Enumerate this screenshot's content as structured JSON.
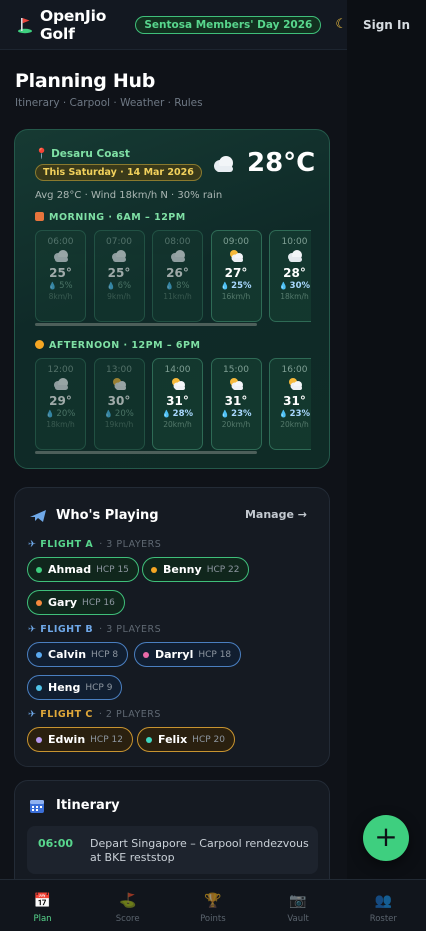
{
  "header": {
    "app_name": "OpenJio Golf",
    "event_pill": "Sentosa Members' Day 2026",
    "theme_icon": "moon-icon",
    "sign_in": "Sign In"
  },
  "hub": {
    "title": "Planning Hub",
    "subtitle": "Itinerary · Carpool · Weather · Rules"
  },
  "weather": {
    "location": "Desaru Coast",
    "date_pill": "This Saturday · 14 Mar 2026",
    "temperature": "28°C",
    "summary": "Avg 28°C · Wind 18km/h N · 30% rain",
    "morning": {
      "label": "MORNING · 6AM – 12PM",
      "hours": [
        {
          "time": "06:00",
          "icon": "cloud-icon",
          "temp": "25°",
          "rain": "5%",
          "wind": "8km/h",
          "highlight": false
        },
        {
          "time": "07:00",
          "icon": "cloud-icon",
          "temp": "25°",
          "rain": "6%",
          "wind": "9km/h",
          "highlight": false
        },
        {
          "time": "08:00",
          "icon": "cloud-icon",
          "temp": "26°",
          "rain": "8%",
          "wind": "11km/h",
          "highlight": false
        },
        {
          "time": "09:00",
          "icon": "partly-sunny-icon",
          "temp": "27°",
          "rain": "25%",
          "wind": "16km/h",
          "highlight": true
        },
        {
          "time": "10:00",
          "icon": "cloud-icon",
          "temp": "28°",
          "rain": "30%",
          "wind": "18km/h",
          "highlight": true
        }
      ]
    },
    "afternoon": {
      "label": "AFTERNOON · 12PM – 6PM",
      "hours": [
        {
          "time": "12:00",
          "icon": "cloud-icon",
          "temp": "29°",
          "rain": "20%",
          "wind": "18km/h",
          "highlight": false
        },
        {
          "time": "13:00",
          "icon": "partly-sunny-icon",
          "temp": "30°",
          "rain": "20%",
          "wind": "19km/h",
          "highlight": false
        },
        {
          "time": "14:00",
          "icon": "partly-sunny-icon",
          "temp": "31°",
          "rain": "28%",
          "wind": "20km/h",
          "highlight": true
        },
        {
          "time": "15:00",
          "icon": "partly-sunny-icon",
          "temp": "31°",
          "rain": "23%",
          "wind": "20km/h",
          "highlight": true
        },
        {
          "time": "16:00",
          "icon": "partly-sunny-icon",
          "temp": "31°",
          "rain": "23%",
          "wind": "20km/h",
          "highlight": true
        }
      ]
    }
  },
  "players": {
    "title": "Who's Playing",
    "manage": "Manage →",
    "flights": [
      {
        "name": "FLIGHT A",
        "count": "3 PLAYERS",
        "color": "#58d68d",
        "players": [
          {
            "name": "Ahmad",
            "hcp": "HCP 15",
            "dot": "#3ecf7f"
          },
          {
            "name": "Benny",
            "hcp": "HCP 22",
            "dot": "#f5a623"
          },
          {
            "name": "Gary",
            "hcp": "HCP 16",
            "dot": "#f58a3d"
          }
        ]
      },
      {
        "name": "FLIGHT B",
        "count": "3 PLAYERS",
        "color": "#6fa8e8",
        "players": [
          {
            "name": "Calvin",
            "hcp": "HCP 8",
            "dot": "#5aa9f0"
          },
          {
            "name": "Darryl",
            "hcp": "HCP 18",
            "dot": "#e86aa8"
          },
          {
            "name": "Heng",
            "hcp": "HCP 9",
            "dot": "#4fc3e8"
          }
        ]
      },
      {
        "name": "FLIGHT C",
        "count": "2 PLAYERS",
        "color": "#e0a83a",
        "players": [
          {
            "name": "Edwin",
            "hcp": "HCP 12",
            "dot": "#b79af0"
          },
          {
            "name": "Felix",
            "hcp": "HCP 20",
            "dot": "#3fd6c0"
          }
        ]
      }
    ]
  },
  "itinerary": {
    "title": "Itinerary",
    "items": [
      {
        "time": "06:00",
        "text": "Depart Singapore – Carpool rendezvous at BKE reststop"
      }
    ]
  },
  "fab": {
    "label": "+"
  },
  "nav": [
    {
      "label": "Plan",
      "icon": "calendar-icon",
      "active": true
    },
    {
      "label": "Score",
      "icon": "golf-flag-icon",
      "active": false
    },
    {
      "label": "Points",
      "icon": "trophy-icon",
      "active": false
    },
    {
      "label": "Vault",
      "icon": "camera-icon",
      "active": false
    },
    {
      "label": "Roster",
      "icon": "people-icon",
      "active": false
    }
  ],
  "colors": {
    "accent": "#3ecf7f",
    "background": "#0f1218"
  }
}
